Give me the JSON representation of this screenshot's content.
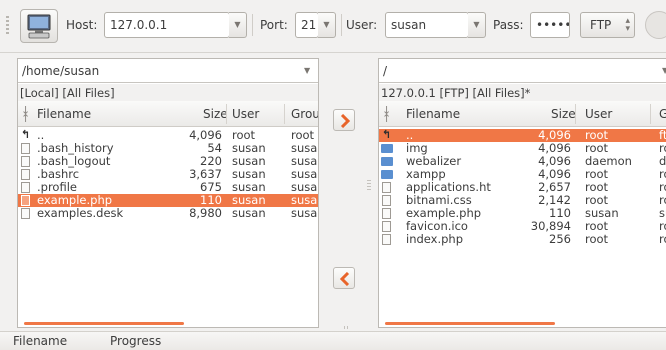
{
  "toolbar": {
    "host_label": "Host:",
    "host_value": "127.0.0.1",
    "port_label": "Port:",
    "port_value": "21",
    "user_label": "User:",
    "user_value": "susan",
    "pass_label": "Pass:",
    "pass_value": "•••••",
    "protocol": "FTP"
  },
  "local": {
    "path": "/home/susan",
    "caption": "[Local] [All Files]",
    "columns": {
      "name": "Filename",
      "size": "Size",
      "user": "User",
      "group": "Grou"
    },
    "rows": [
      {
        "name": "..",
        "size": "4,096",
        "user": "root",
        "group": "root",
        "icon": "up-dir-icon",
        "selected": false
      },
      {
        "name": ".bash_history",
        "size": "54",
        "user": "susan",
        "group": "susa",
        "icon": "file-icon",
        "selected": false
      },
      {
        "name": ".bash_logout",
        "size": "220",
        "user": "susan",
        "group": "susa",
        "icon": "file-icon",
        "selected": false
      },
      {
        "name": ".bashrc",
        "size": "3,637",
        "user": "susan",
        "group": "susa",
        "icon": "file-icon",
        "selected": false
      },
      {
        "name": ".profile",
        "size": "675",
        "user": "susan",
        "group": "susa",
        "icon": "file-icon",
        "selected": false
      },
      {
        "name": "example.php",
        "size": "110",
        "user": "susan",
        "group": "susa",
        "icon": "file-icon",
        "selected": true
      },
      {
        "name": "examples.desk",
        "size": "8,980",
        "user": "susan",
        "group": "susa",
        "icon": "file-icon",
        "selected": false
      }
    ]
  },
  "remote": {
    "path": "/",
    "caption": "127.0.0.1 [FTP] [All Files]*",
    "columns": {
      "name": "Filename",
      "size": "Size",
      "user": "User",
      "group": "G"
    },
    "rows": [
      {
        "name": "..",
        "size": "4,096",
        "user": "root",
        "group": "ft",
        "icon": "up-dir-icon",
        "selected": true
      },
      {
        "name": "img",
        "size": "4,096",
        "user": "root",
        "group": "ro",
        "icon": "folder-icon",
        "selected": false
      },
      {
        "name": "webalizer",
        "size": "4,096",
        "user": "daemon",
        "group": "d",
        "icon": "folder-icon",
        "selected": false
      },
      {
        "name": "xampp",
        "size": "4,096",
        "user": "root",
        "group": "ro",
        "icon": "folder-icon",
        "selected": false
      },
      {
        "name": "applications.ht",
        "size": "2,657",
        "user": "root",
        "group": "ro",
        "icon": "html-file-icon",
        "selected": false
      },
      {
        "name": "bitnami.css",
        "size": "2,142",
        "user": "root",
        "group": "ro",
        "icon": "file-icon",
        "selected": false
      },
      {
        "name": "example.php",
        "size": "110",
        "user": "susan",
        "group": "su",
        "icon": "file-icon",
        "selected": false
      },
      {
        "name": "favicon.ico",
        "size": "30,894",
        "user": "root",
        "group": "ro",
        "icon": "file-icon",
        "selected": false
      },
      {
        "name": "index.php",
        "size": "256",
        "user": "root",
        "group": "ro",
        "icon": "file-icon",
        "selected": false
      }
    ]
  },
  "queue": {
    "col_filename": "Filename",
    "col_progress": "Progress"
  },
  "colors": {
    "selection": "#f07746",
    "folder": "#5a8fd0"
  }
}
